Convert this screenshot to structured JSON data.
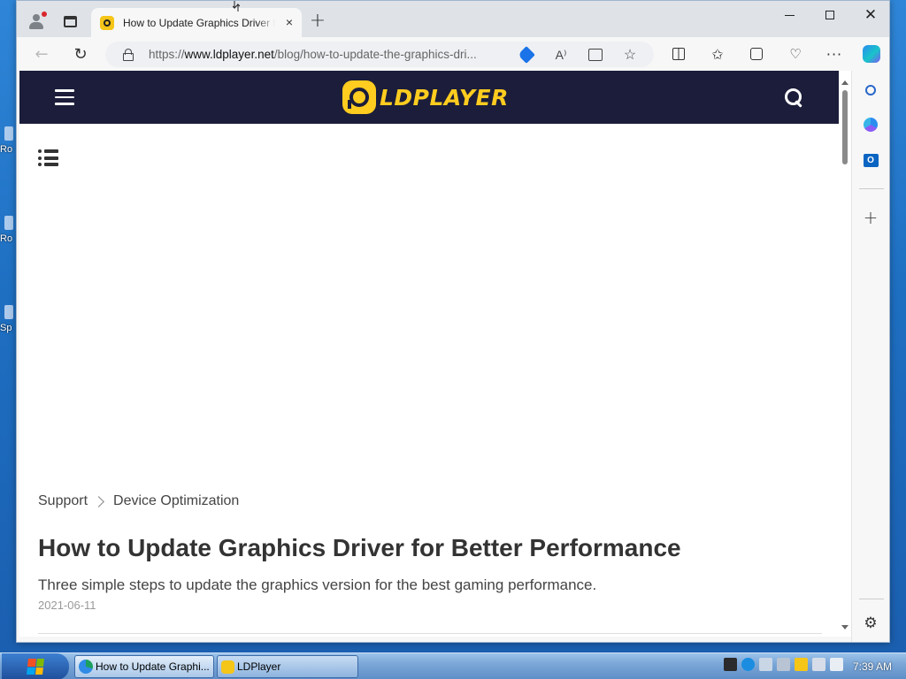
{
  "desktop": {
    "icons": [
      "Ro",
      "Ro",
      "Sp"
    ]
  },
  "browser": {
    "tab": {
      "title": "How to Update Graphics Driver for Better Performance",
      "close": "×"
    },
    "new_tab": "+",
    "url_prefix": "https://",
    "url_host": "www.ldplayer.net",
    "url_path": "/blog/how-to-update-the-graphics-dri...",
    "icons": {
      "back": "back-arrow-icon",
      "reload": "reload-icon",
      "read_aloud": "read-aloud-icon",
      "favorite": "star-icon",
      "more": "more-icon"
    }
  },
  "site": {
    "logo_text": "LDPLAYER",
    "brand_color": "#ffcc1f",
    "header_color": "#1b1d3a"
  },
  "article": {
    "breadcrumb": [
      "Support",
      "Device Optimization"
    ],
    "title": "How to Update Graphics Driver for Better Performance",
    "subtitle": "Three simple steps to update the graphics version for the best gaming performance.",
    "date": "2021-06-11"
  },
  "taskbar": {
    "tasks": [
      "How to Update Graphi...",
      "LDPlayer"
    ],
    "time": "7:39 AM"
  }
}
